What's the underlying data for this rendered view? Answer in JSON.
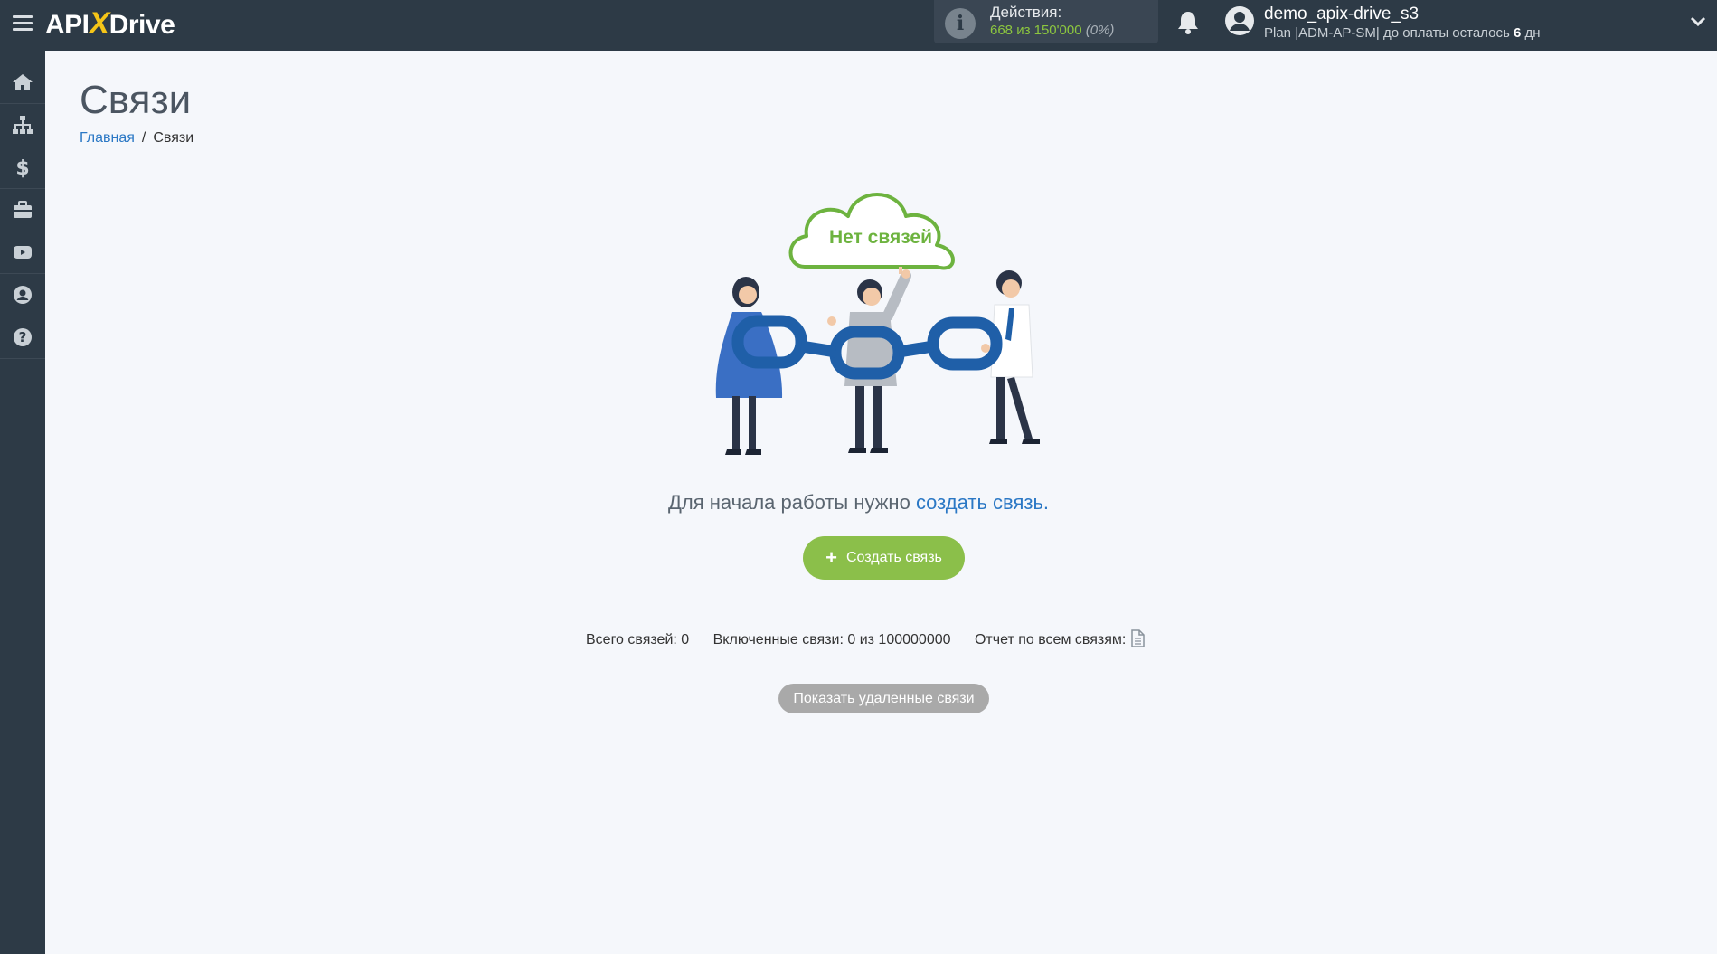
{
  "header": {
    "logo": {
      "left": "API",
      "x": "X",
      "right": "Drive"
    },
    "actions": {
      "title": "Действия:",
      "count": "668 из 150'000",
      "percent": "(0%)"
    },
    "user": {
      "name": "demo_apix-drive_s3",
      "plan_prefix": "Plan |ADM-AP-SM| до оплаты осталось ",
      "days": "6",
      "days_suffix": " дн"
    }
  },
  "sidebar": {
    "items": [
      {
        "icon": "home-icon"
      },
      {
        "icon": "sitemap-icon"
      },
      {
        "icon": "dollar-icon"
      },
      {
        "icon": "briefcase-icon"
      },
      {
        "icon": "youtube-icon"
      },
      {
        "icon": "user-circle-icon"
      },
      {
        "icon": "question-circle-icon"
      }
    ]
  },
  "page": {
    "title": "Связи",
    "breadcrumb": {
      "home": "Главная",
      "separator": "/",
      "current": "Связи"
    }
  },
  "empty_state": {
    "cloud_label": "Нет связей",
    "text_prefix": "Для начала работы нужно ",
    "text_link": "создать связь",
    "text_suffix": ".",
    "create_button": "Создать связь"
  },
  "stats": {
    "total": "Всего связей: 0",
    "enabled": "Включенные связи: 0 из 100000000",
    "report": "Отчет по всем связям:"
  },
  "show_deleted_button": "Показать удаленные связи",
  "colors": {
    "topbar": "#2d3a46",
    "accent_green": "#8bbf4a",
    "link_blue": "#2b78c5",
    "chain_blue": "#1f5fa8"
  }
}
